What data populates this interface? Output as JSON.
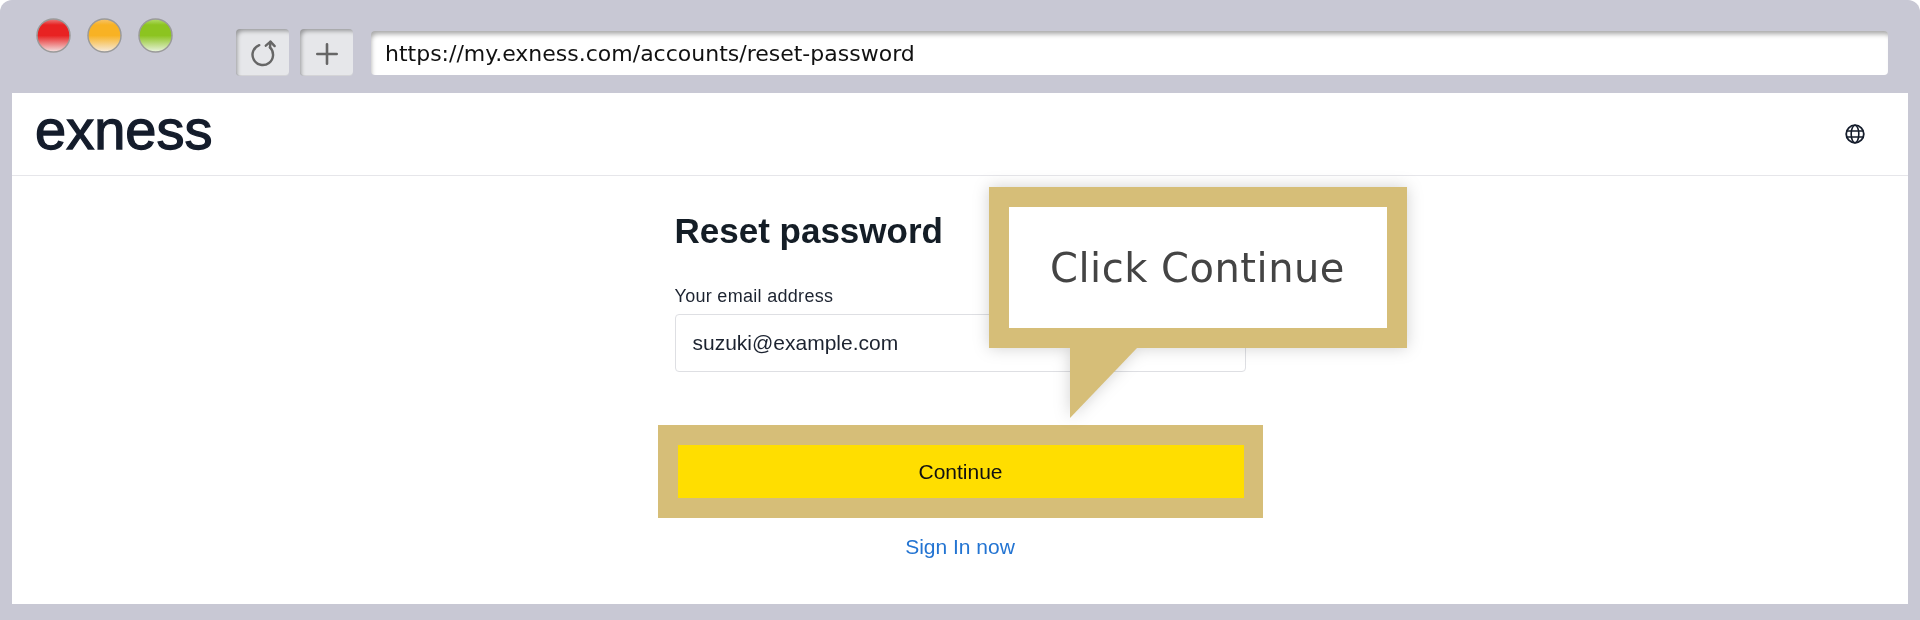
{
  "browser": {
    "url": "https://my.exness.com/accounts/reset-password"
  },
  "header": {
    "logo": "exness"
  },
  "form": {
    "title": "Reset password",
    "email": {
      "label": "Your email address",
      "value": "suzuki@example.com"
    },
    "submit": {
      "label": "Continue",
      "highlighted": true
    },
    "sign_in_link": "Sign In now"
  },
  "callout": {
    "text": "Click Continue"
  }
}
